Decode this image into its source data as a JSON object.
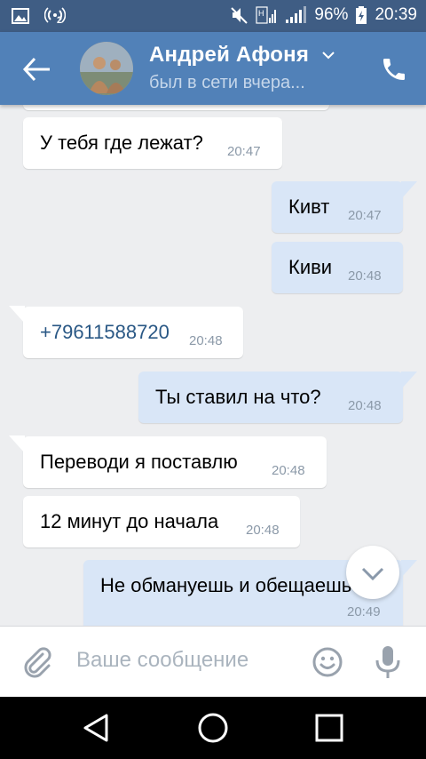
{
  "status_bar": {
    "battery_percent": "96%",
    "time": "20:39",
    "network_badge": "2"
  },
  "header": {
    "contact_name": "Андрей Афоня",
    "contact_status": "был в сети вчера..."
  },
  "messages": [
    {
      "direction": "in",
      "text": "У тебя где лежат?",
      "time": "20:47"
    },
    {
      "direction": "out",
      "text": "Кивт",
      "time": "20:47"
    },
    {
      "direction": "out",
      "text": "Киви",
      "time": "20:48"
    },
    {
      "direction": "in",
      "text": "+79611588720",
      "time": "20:48",
      "is_link": true
    },
    {
      "direction": "out",
      "text": "Ты ставил на что?",
      "time": "20:48"
    },
    {
      "direction": "in",
      "text": "Переводи я поставлю",
      "time": "20:48"
    },
    {
      "direction": "in",
      "text": "12 минут до начала",
      "time": "20:48"
    },
    {
      "direction": "out",
      "text": "Не обмануешь и обещаешь?",
      "time": "20:49"
    }
  ],
  "composer": {
    "placeholder": "Ваше сообщение"
  },
  "colors": {
    "header": "#5181b8",
    "status_bar": "#3f5d84",
    "chat_bg": "#edeef0",
    "bubble_in": "#ffffff",
    "bubble_out": "#d9e6f7",
    "link": "#2a5885"
  },
  "icons": {
    "back": "arrow-left-icon",
    "call": "phone-icon",
    "chevron": "chevron-down-icon",
    "attach": "paperclip-icon",
    "emoji": "smiley-icon",
    "mic": "microphone-icon",
    "scroll_down": "chevron-down-icon"
  }
}
